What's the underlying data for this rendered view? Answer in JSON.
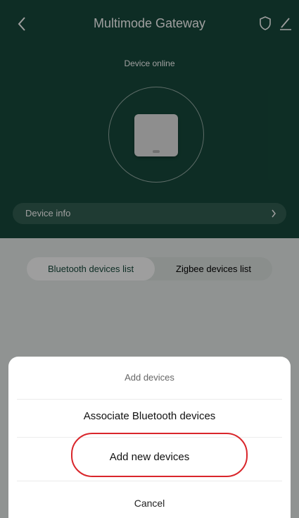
{
  "header": {
    "title": "Multimode Gateway"
  },
  "device": {
    "status": "Device online",
    "info_label": "Device info"
  },
  "tabs": [
    {
      "label": "Bluetooth devices list",
      "active": true
    },
    {
      "label": "Zigbee devices list",
      "active": false
    }
  ],
  "sheet": {
    "title": "Add devices",
    "options": [
      {
        "label": "Associate Bluetooth devices"
      },
      {
        "label": "Add new devices",
        "highlighted": true
      },
      {
        "label": "Cancel"
      }
    ]
  },
  "colors": {
    "hero_bg": "#174a3c",
    "highlight_ring": "#d9262b"
  },
  "icons": [
    "back-arrow-icon",
    "shield-icon",
    "edit-icon",
    "chevron-right-icon",
    "gateway-device-icon"
  ]
}
